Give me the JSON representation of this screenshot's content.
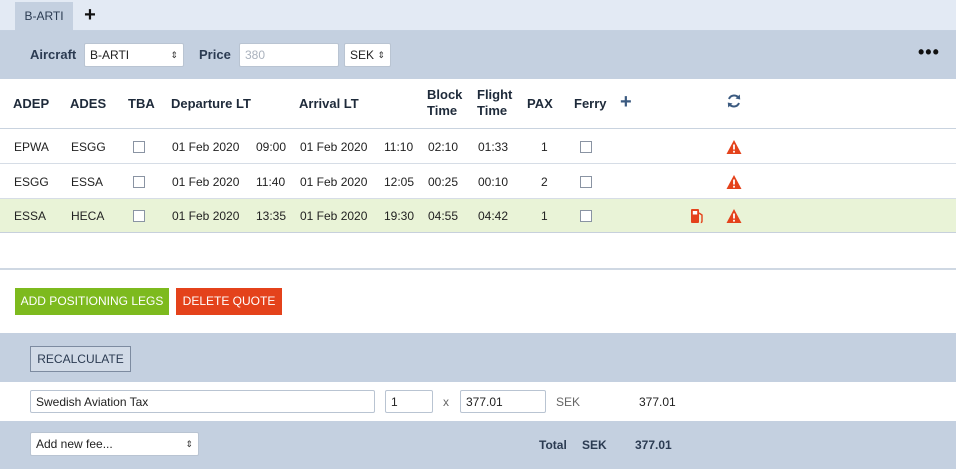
{
  "tabs": {
    "active_label": "B-ARTI",
    "add_label": "+"
  },
  "aircraft_bar": {
    "aircraft_label": "Aircraft",
    "aircraft_value": "B-ARTI",
    "price_label": "Price",
    "price_placeholder": "380",
    "currency_value": "SEK",
    "more_label": "•••"
  },
  "table": {
    "headers": {
      "adep": "ADEP",
      "ades": "ADES",
      "tba": "TBA",
      "departure": "Departure LT",
      "arrival": "Arrival LT",
      "block_1": "Block",
      "block_2": "Time",
      "flight_1": "Flight",
      "flight_2": "Time",
      "pax": "PAX",
      "ferry": "Ferry"
    },
    "rows": [
      {
        "adep": "EPWA",
        "ades": "ESGG",
        "dep_date": "01 Feb 2020",
        "dep_time": "09:00",
        "arr_date": "01 Feb 2020",
        "arr_time": "11:10",
        "block": "02:10",
        "flight": "01:33",
        "pax": "1"
      },
      {
        "adep": "ESGG",
        "ades": "ESSA",
        "dep_date": "01 Feb 2020",
        "dep_time": "11:40",
        "arr_date": "01 Feb 2020",
        "arr_time": "12:05",
        "block": "00:25",
        "flight": "00:10",
        "pax": "2"
      },
      {
        "adep": "ESSA",
        "ades": "HECA",
        "dep_date": "01 Feb 2020",
        "dep_time": "13:35",
        "arr_date": "01 Feb 2020",
        "arr_time": "19:30",
        "block": "04:55",
        "flight": "04:42",
        "pax": "1"
      }
    ]
  },
  "actions": {
    "add_positioning": "ADD POSITIONING LEGS",
    "delete_quote": "DELETE QUOTE",
    "recalculate": "RECALCULATE"
  },
  "fee": {
    "name": "Swedish Aviation Tax",
    "quantity": "1",
    "times": "x",
    "unit_price": "377.01",
    "currency": "SEK",
    "amount": "377.01"
  },
  "footer": {
    "add_fee_placeholder": "Add new fee...",
    "total_label": "Total",
    "total_currency": "SEK",
    "total_amount": "377.01"
  },
  "colors": {
    "warning": "#e4421b",
    "highlight_row": "#e9f3d7",
    "green_button": "#7dba1e",
    "red_button": "#e4421b",
    "bar_bg": "#c4d0e0"
  }
}
